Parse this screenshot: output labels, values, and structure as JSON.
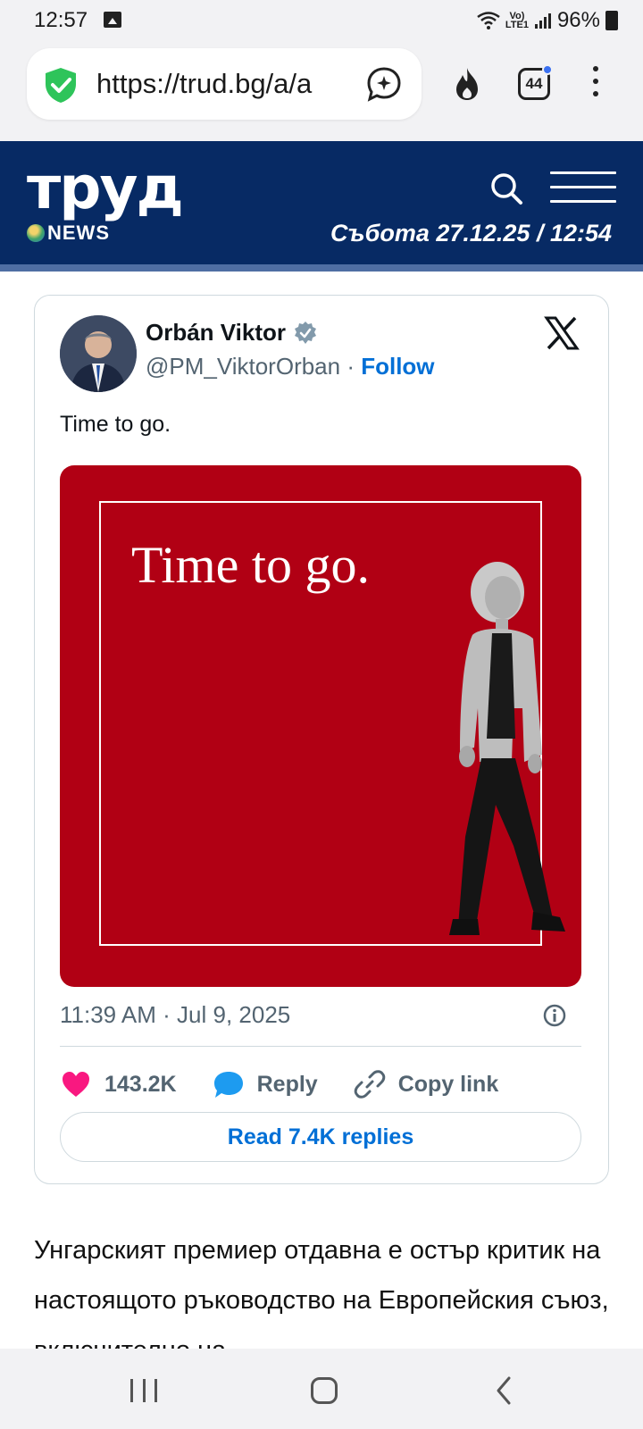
{
  "status_bar": {
    "time": "12:57",
    "network_label_top": "Vo)",
    "network_label_bottom": "LTE1",
    "battery": "96%"
  },
  "browser": {
    "url": "https://trud.bg/a/a",
    "tab_count": "44",
    "icons": [
      "shield-check-icon",
      "assistant-icon",
      "fire-icon",
      "tabs-icon",
      "more-vert-icon"
    ]
  },
  "site": {
    "logo_text": "труд",
    "logo_sub": "NEWS",
    "date_time": "Събота 27.12.25 / 12:54",
    "colors": {
      "header_bg": "#072a64",
      "header_stripe": "#4f6ea3"
    }
  },
  "tweet": {
    "author_name": "Orbán Viktor",
    "handle": "@PM_ViktorOrban",
    "separator": " · ",
    "follow": "Follow",
    "text": "Time to go.",
    "media_caption": "Time to go.",
    "timestamp": "11:39 AM · Jul 9, 2025",
    "likes": "143.2K",
    "reply": "Reply",
    "copy_link": "Copy link",
    "read_replies": "Read 7.4K replies",
    "colors": {
      "link": "#006fd6",
      "heart": "#f91880",
      "reply": "#1d9bf0",
      "media_bg": "#b10014"
    }
  },
  "article": {
    "text": "Унгарският премиер отдавна е остър критик на настоящото ръководство на Европейския съюз, включително на"
  }
}
